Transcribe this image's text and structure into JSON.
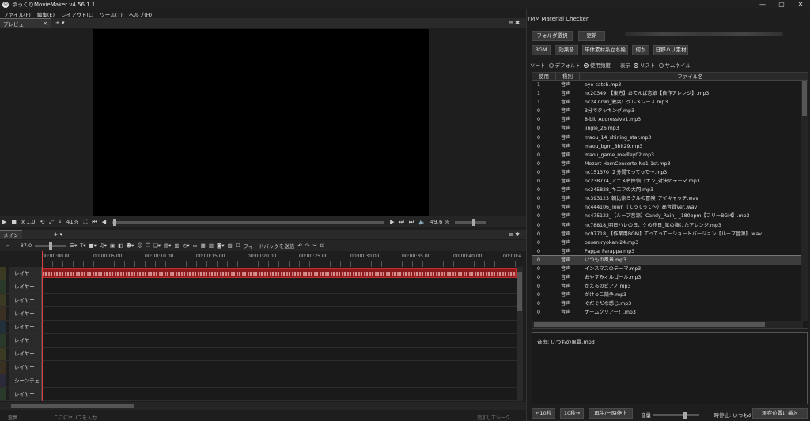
{
  "titlebar": {
    "title": "ゆっくりMovieMaker v4.56.1.1",
    "minimize": "—",
    "maximize": "▢",
    "close": "✕"
  },
  "menu": [
    "ファイル(F)",
    "編集(E)",
    "レイアウト(L)",
    "ツール(T)",
    "ヘルプ(H)"
  ],
  "preview": {
    "tab_label": "プレビュー",
    "tab_close": "✕",
    "add": "+ ▾",
    "speed": "x 1.0",
    "zoom": "41%",
    "volume_pct": "49.6 %"
  },
  "timeline": {
    "tab_label": "メイン",
    "add": "+ ▾",
    "zoom_value": "87.0",
    "feedback": "フィードバックを送信",
    "ruler": [
      "00:00:00.00",
      "00:00:05.00",
      "00:00:10.00",
      "00:00:15.00",
      "00:00:20.00",
      "00:00:25.00",
      "00:00:30.00",
      "00:00:35.00",
      "00:00:40.00",
      "00:00:4"
    ],
    "layers": [
      "レイヤー 00",
      "レイヤー 01",
      "レイヤー 02",
      "レイヤー 03",
      "レイヤー 04",
      "レイヤー 05",
      "レイヤー 06",
      "レイヤー 07",
      "シーンチェンジ",
      "レイヤー 09"
    ]
  },
  "status": {
    "left": "霊夢",
    "input_placeholder": "ここにセリフを入力",
    "right": "追加してシーク"
  },
  "checker": {
    "title": "YMM Material Checker",
    "folder_button": "フォルダ選択",
    "refresh_button": "更新",
    "category_buttons": [
      "BGM",
      "効果音",
      "単体素材系立ち絵",
      "何か",
      "日野ハリ素材"
    ],
    "sort_label": "ソート",
    "sort_default": "デフォルト",
    "sort_usage": "使用頻度",
    "display_label": "表示",
    "display_list": "リスト",
    "display_thumb": "サムネイル",
    "columns": [
      "使用",
      "種別",
      "ファイル名"
    ],
    "rows": [
      [
        "1",
        "音声",
        "eye-catch.mp3"
      ],
      [
        "1",
        "音声",
        "nc20349_【東方】おてんば恋娘【自作アレンジ】.mp3"
      ],
      [
        "1",
        "音声",
        "nc247790_激突！グルメレース.mp3"
      ],
      [
        "0",
        "音声",
        "3分でクッキング.mp3"
      ],
      [
        "0",
        "音声",
        "8-bit_Aggressive1.mp3"
      ],
      [
        "0",
        "音声",
        "jingle_26.mp3"
      ],
      [
        "0",
        "音声",
        "maou_14_shining_star.mp3"
      ],
      [
        "0",
        "音声",
        "maou_bgm_8bit29.mp3"
      ],
      [
        "0",
        "音声",
        "maou_game_medley02.mp3"
      ],
      [
        "0",
        "音声",
        "Mozart-HornConcerto-No1-1st.mp3"
      ],
      [
        "0",
        "音声",
        "nc151370_２分間てってって～.mp3"
      ],
      [
        "0",
        "音声",
        "nc238774_アニメ名探偵コナン_対決のテーマ.mp3"
      ],
      [
        "0",
        "音声",
        "nc245828_キエフの大門.mp3"
      ],
      [
        "0",
        "音声",
        "nc393123_朝比奈ミクルの冒険_アイキャッチ.wav"
      ],
      [
        "0",
        "音声",
        "nc444106_Town（てってって～）高音質Ver..wav"
      ],
      [
        "0",
        "音声",
        "nc475122_【ループ音源】Candy_Rain_-_180bpm【フリーBGM】.mp3"
      ],
      [
        "0",
        "音声",
        "nc78818_明日ハレの日、ケの昨日_気の抜けたアレンジ.mp3"
      ],
      [
        "0",
        "音声",
        "nc97718_【作業用BGM】てってってーショートバージョン【ループ音源】.wav"
      ],
      [
        "0",
        "音声",
        "onsen-ryokan-24.mp3"
      ],
      [
        "0",
        "音声",
        "Pappa_Parappa.mp3"
      ],
      [
        "0",
        "音声",
        "いつもの風景.mp3"
      ],
      [
        "0",
        "音声",
        "インスマスのテーマ.mp3"
      ],
      [
        "0",
        "音声",
        "おやすみオルゴール.mp3"
      ],
      [
        "0",
        "音声",
        "かえるのピアノ.mp3"
      ],
      [
        "0",
        "音声",
        "がけっこ競争.mp3"
      ],
      [
        "0",
        "音声",
        "ぐだぐだな感じ.mp3"
      ],
      [
        "0",
        "音声",
        "ゲームクリアー！.mp3"
      ]
    ],
    "selected_row": 20,
    "detail_text": "音声: いつもの風景.mp3",
    "back_button": "←10秒",
    "fwd_button": "10秒→",
    "play_button": "再生/一時停止",
    "volume_label": "音量",
    "pause_text": "一時停止: いつもの風",
    "insert_button": "現在位置に挿入"
  }
}
